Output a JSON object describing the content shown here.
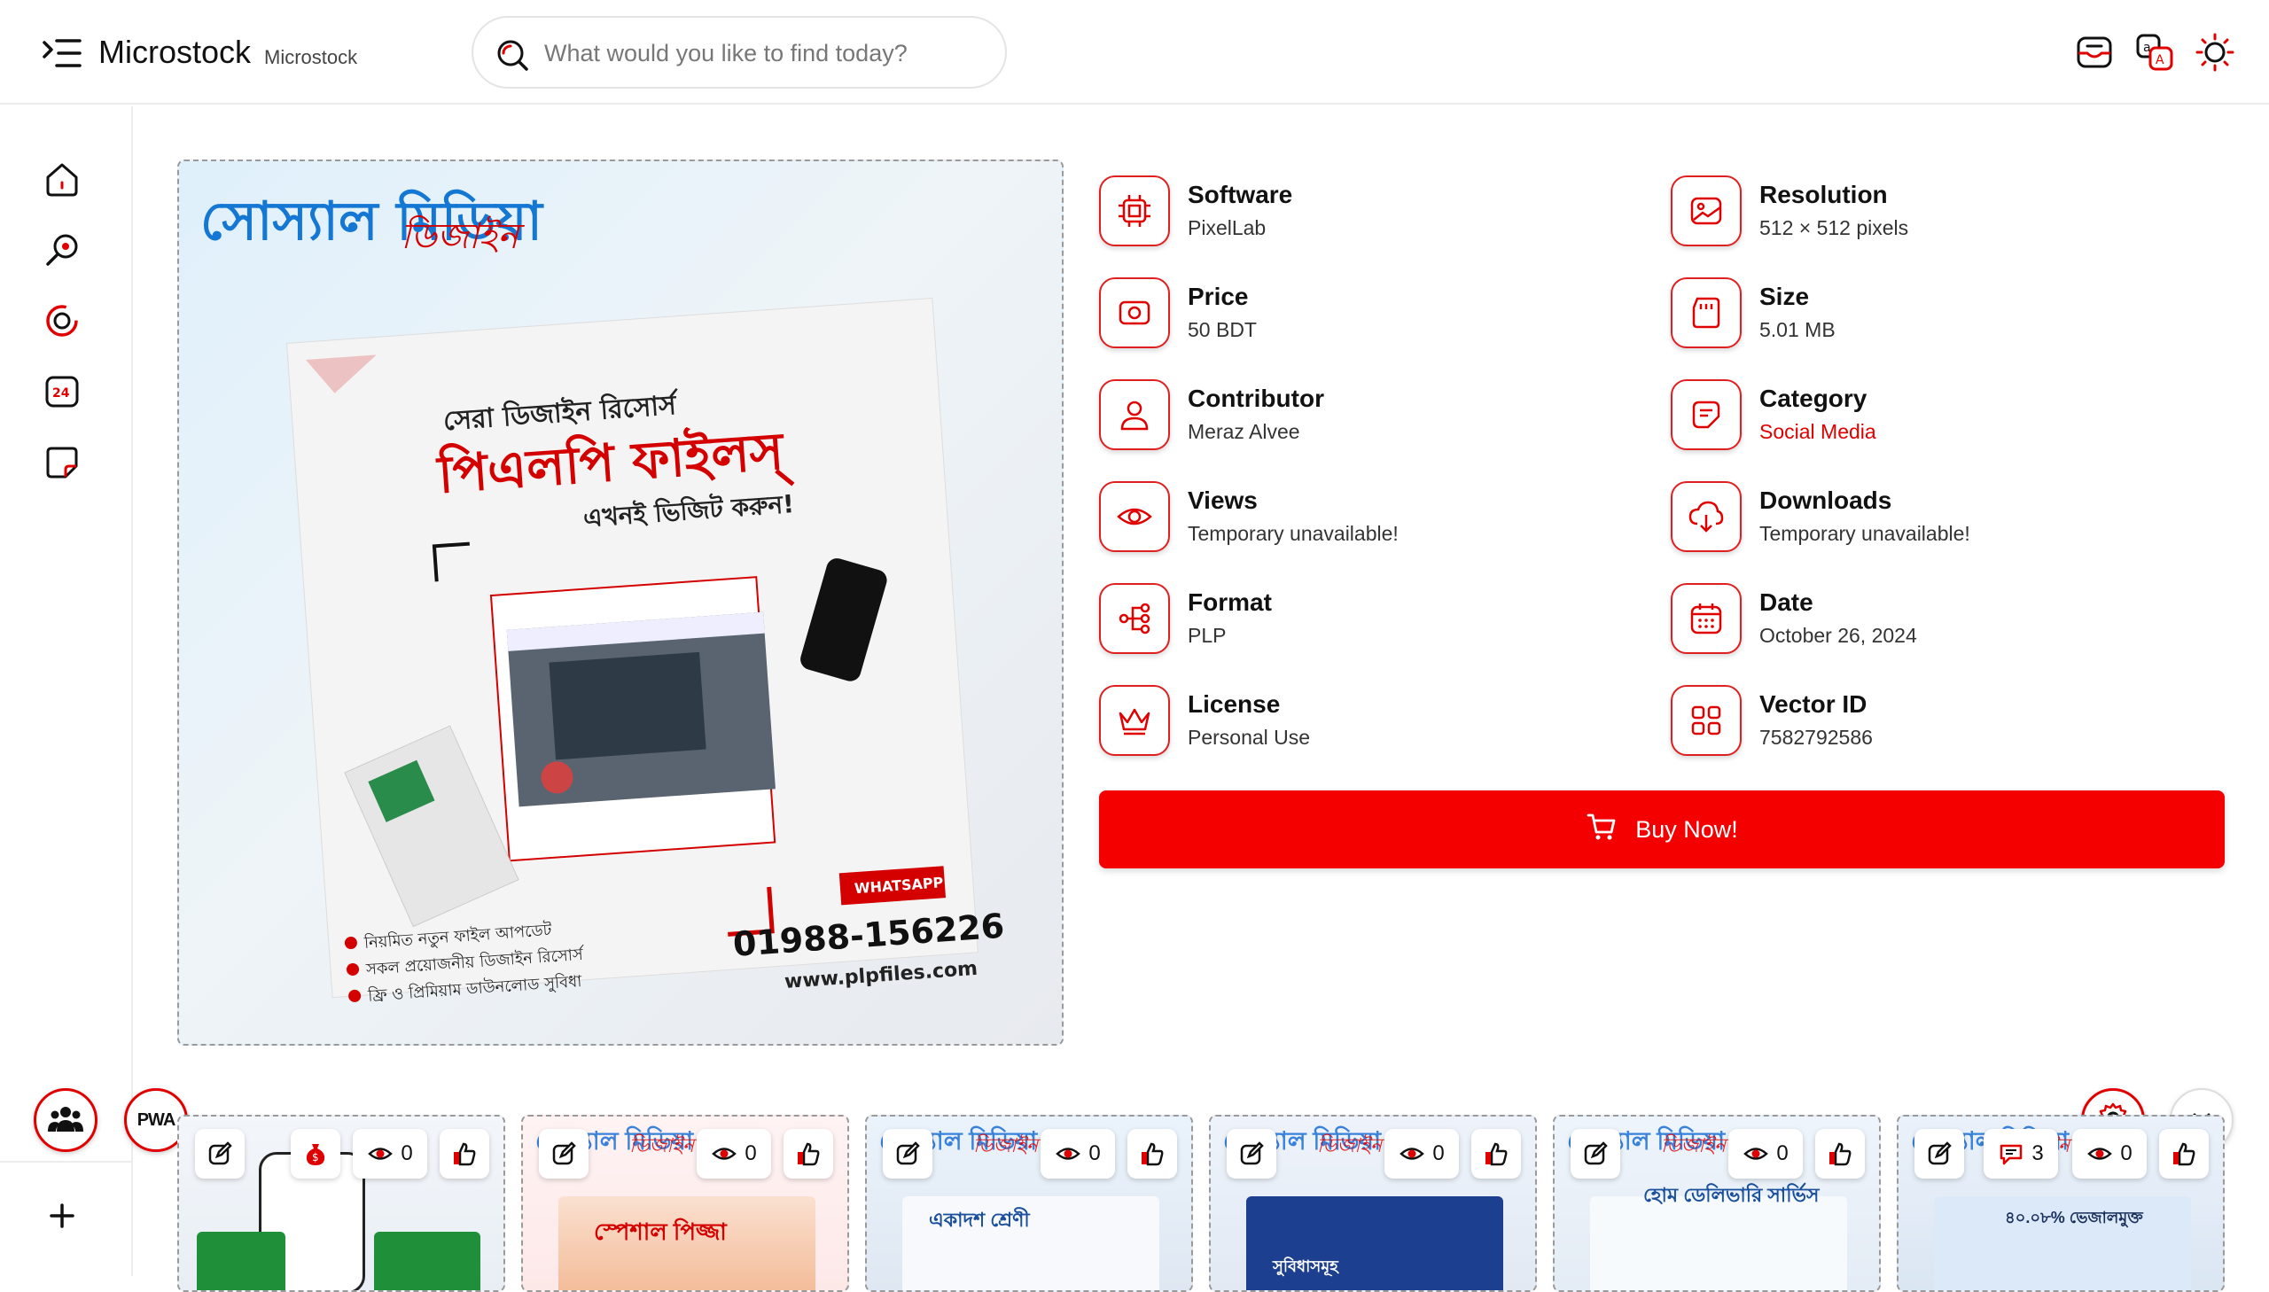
{
  "header": {
    "brand": "Microstock",
    "brand_sub": "Microstock",
    "search_placeholder": "What would you like to find today?"
  },
  "preview": {
    "headline_blue": "সোস্যাল মিডিয়া",
    "headline_sub": "ডিজাইন",
    "tagline1": "সেরা ডিজাইন রিসোর্স",
    "tagline2": "পিএলপি ফাইলস্",
    "tagline3": "এখনই ভিজিট করুন!",
    "bullet1": "নিয়মিত নতুন ফাইল আপডেট",
    "bullet2": "সকল প্রয়োজনীয় ডিজাইন রিসোর্স",
    "bullet3": "ফ্রি ও প্রিমিয়াম ডাউনলোড সুবিধা",
    "whatsapp": "WHATSAPP",
    "phone": "01988-156226",
    "website": "www.plpfiles.com"
  },
  "info": {
    "software": {
      "label": "Software",
      "value": "PixelLab"
    },
    "resolution": {
      "label": "Resolution",
      "value": "512 × 512 pixels"
    },
    "price": {
      "label": "Price",
      "value": "50 BDT"
    },
    "size": {
      "label": "Size",
      "value": "5.01 MB"
    },
    "contributor": {
      "label": "Contributor",
      "value": "Meraz Alvee"
    },
    "category": {
      "label": "Category",
      "value": "Social Media"
    },
    "views": {
      "label": "Views",
      "value": "Temporary unavailable!"
    },
    "downloads": {
      "label": "Downloads",
      "value": "Temporary unavailable!"
    },
    "format": {
      "label": "Format",
      "value": "PLP"
    },
    "date": {
      "label": "Date",
      "value": "October 26, 2024"
    },
    "license": {
      "label": "License",
      "value": "Personal Use"
    },
    "vector_id": {
      "label": "Vector ID",
      "value": "7582792586"
    }
  },
  "buy_label": "Buy Now!",
  "pwa_label": "PWA",
  "cards": [
    {
      "views": "0",
      "title": "",
      "title2": "",
      "body_text": ""
    },
    {
      "views": "0",
      "title": "সোস্যাল মিডিয়া",
      "title2": "ডিজাইন",
      "body_text": "স্পেশাল পিজ্জা"
    },
    {
      "views": "0",
      "title": "সোস্যাল মিডিয়া",
      "title2": "ডিজাইন",
      "body_text": "একাদশ শ্রেণী"
    },
    {
      "views": "0",
      "title": "সোস্যাল মিডিয়া",
      "title2": "ডিজাইন",
      "body_text": "সুবিধাসমূহ"
    },
    {
      "views": "0",
      "title": "সোস্যাল মিডিয়া",
      "title2": "ডিজাইন",
      "body_text": "হোম ডেলিভারি সার্ভিস"
    },
    {
      "views": "0",
      "comments": "3",
      "title": "সোস্যাল মিডিয়া",
      "title2": "ডিজাইন",
      "body_text": "৪০.০৮% ভেজালমুক্ত"
    }
  ],
  "colors": {
    "accent": "#f40000",
    "accent_border": "#e02020"
  }
}
